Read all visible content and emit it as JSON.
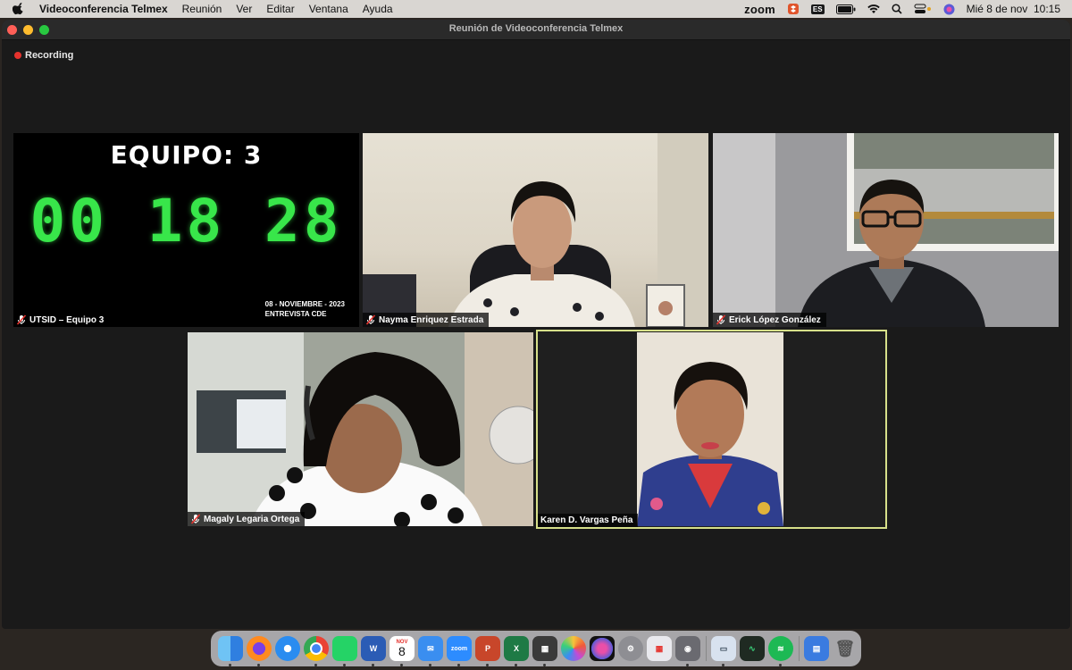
{
  "menubar": {
    "app_name": "Videoconferencia Telmex",
    "menus": [
      "Reunión",
      "Ver",
      "Editar",
      "Ventana",
      "Ayuda"
    ],
    "zoom_label": "zoom",
    "input_source": "ES",
    "datetime": "Mié 8 de nov  10:15"
  },
  "window": {
    "title": "Reunión de Videoconferencia Telmex",
    "recording_label": "Recording"
  },
  "equipo_screen": {
    "title": "EQUIPO: 3",
    "timer": "00 18 28",
    "date_line": "08 - NOVIEMBRE - 2023",
    "subtitle_line": "ENTREVISTA CDE"
  },
  "participants": [
    {
      "name": "UTSID – Equipo 3",
      "muted": true
    },
    {
      "name": "Nayma Enriquez Estrada",
      "muted": true
    },
    {
      "name": "Erick López González",
      "muted": true
    },
    {
      "name": "Magaly Legaria Ortega",
      "muted": true
    },
    {
      "name": "Karen D. Vargas Peña",
      "muted": false,
      "active_speaker": true
    }
  ],
  "dock": {
    "calendar_month": "NOV",
    "calendar_day": "8",
    "zoom_icon_label": "zoom"
  },
  "colors": {
    "active_speaker_border": "#d7e08a",
    "timer_green": "#38e64a",
    "recording_red": "#e5322d"
  }
}
